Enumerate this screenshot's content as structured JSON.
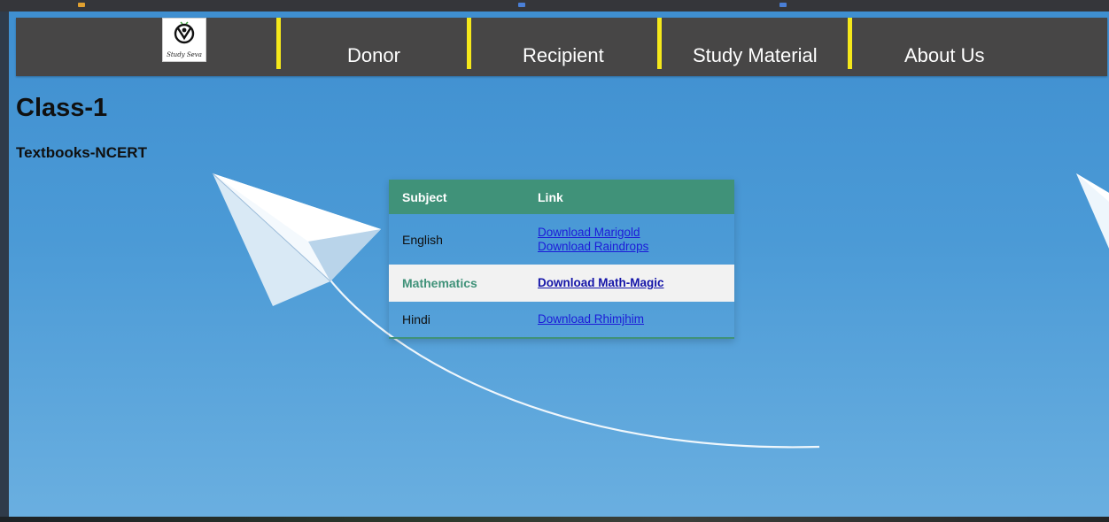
{
  "nav": {
    "logo_text": "Study Seva",
    "items": [
      {
        "label": "Donor"
      },
      {
        "label": "Recipient"
      },
      {
        "label": "Study Material"
      },
      {
        "label": "About Us"
      }
    ]
  },
  "page": {
    "title": "Class-1",
    "subtitle": "Textbooks-NCERT"
  },
  "table": {
    "headers": [
      "Subject",
      "Link"
    ],
    "rows": [
      {
        "subject": "English",
        "links": [
          "Download Marigold",
          "Download Raindrops"
        ]
      },
      {
        "subject": "Mathematics",
        "links": [
          "Download Math-Magic"
        ]
      },
      {
        "subject": "Hindi",
        "links": [
          "Download Rhimjhim"
        ]
      }
    ]
  },
  "colors": {
    "nav_bg": "#474646",
    "nav_separator": "#f5e81a",
    "table_header": "#409279",
    "link": "#1c1cd8",
    "page_bg": "#4b9ad6"
  },
  "icons": [
    "study-seva-logo-icon",
    "paper-plane-icon"
  ]
}
